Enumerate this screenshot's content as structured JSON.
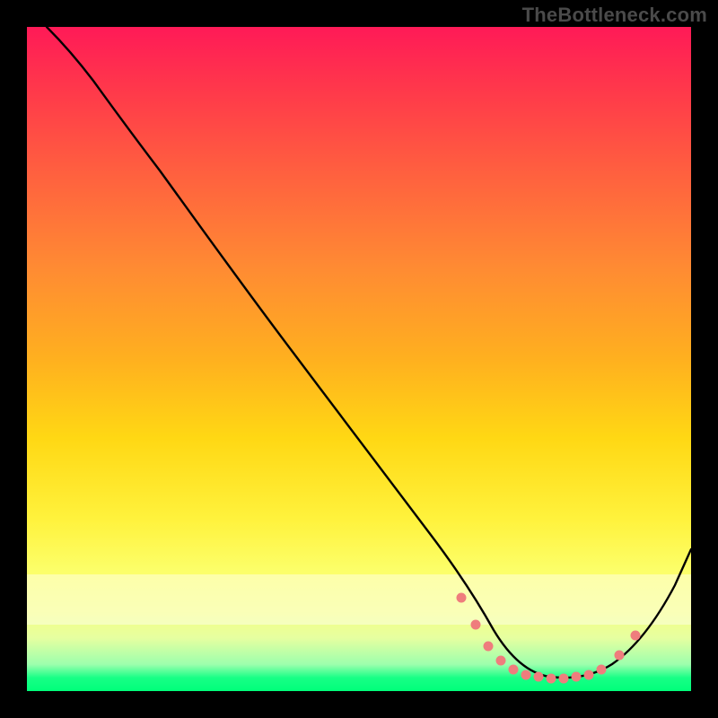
{
  "watermark": "TheBottleneck.com",
  "chart_data": {
    "type": "line",
    "title": "",
    "xlabel": "",
    "ylabel": "",
    "xlim": [
      0,
      100
    ],
    "ylim": [
      0,
      100
    ],
    "grid": false,
    "legend": false,
    "series": [
      {
        "name": "curve",
        "color": "#000000",
        "x": [
          3,
          7,
          10,
          15,
          20,
          30,
          40,
          50,
          60,
          65,
          70,
          75,
          80,
          85,
          90,
          95,
          100
        ],
        "y": [
          100,
          97,
          94,
          89,
          83,
          70,
          57,
          44,
          31,
          22,
          10,
          4,
          2,
          2,
          7,
          16,
          26
        ]
      }
    ],
    "markers": [
      {
        "name": "dots",
        "color": "#f07878",
        "x": [
          65,
          68,
          70,
          72,
          74,
          76,
          78,
          80,
          82,
          84,
          86,
          88,
          90,
          92
        ],
        "y": [
          15,
          9,
          6,
          4,
          3,
          2.5,
          2.2,
          2,
          2,
          2.2,
          2.6,
          4,
          7,
          11
        ]
      }
    ],
    "background_gradient": {
      "top": "#ff1a57",
      "bottom": "#00ff7a"
    }
  }
}
